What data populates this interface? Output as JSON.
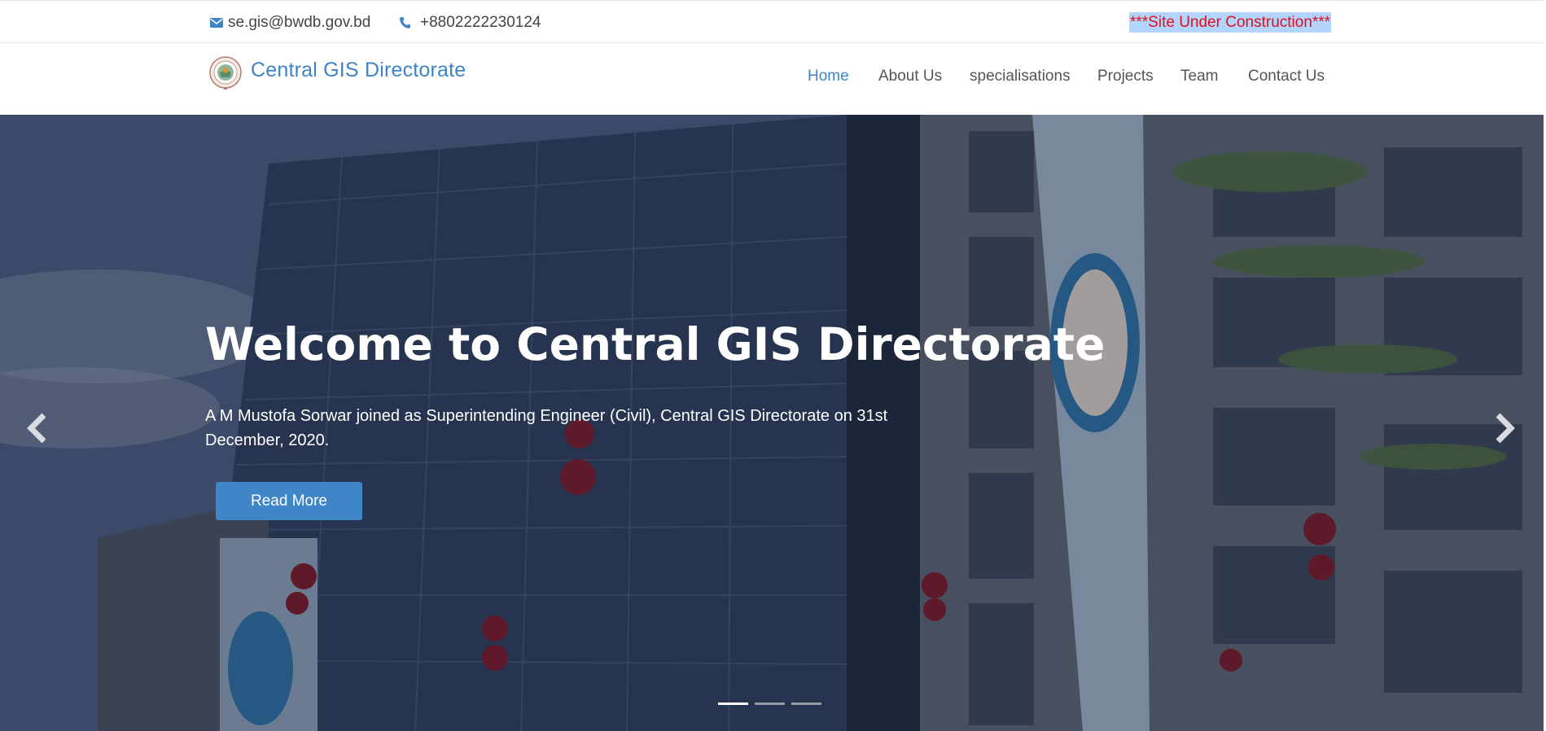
{
  "topbar": {
    "email": "se.gis@bwdb.gov.bd",
    "phone": "+8802222230124",
    "notice": "***Site Under Construction***"
  },
  "header": {
    "brand": "Central GIS Directorate",
    "nav": [
      {
        "label": "Home",
        "active": true
      },
      {
        "label": "About Us",
        "active": false
      },
      {
        "label": "specialisations",
        "active": false
      },
      {
        "label": "Projects",
        "active": false
      },
      {
        "label": "Team",
        "active": false
      },
      {
        "label": "Contact Us",
        "active": false
      }
    ]
  },
  "hero": {
    "title": "Welcome to Central GIS Directorate",
    "subtitle": "A M Mustofa Sorwar joined as Superintending Engineer (Civil), Central GIS Directorate on 31st December, 2020.",
    "cta": "Read More",
    "slide_count": 3,
    "active_slide": 1
  },
  "colors": {
    "accent": "#3f84c6",
    "notice_text": "#e0101a",
    "notice_highlight": "#b3d4fc"
  },
  "icons": {
    "email": "envelope-icon",
    "phone": "phone-icon",
    "prev": "chevron-left-icon",
    "next": "chevron-right-icon"
  }
}
